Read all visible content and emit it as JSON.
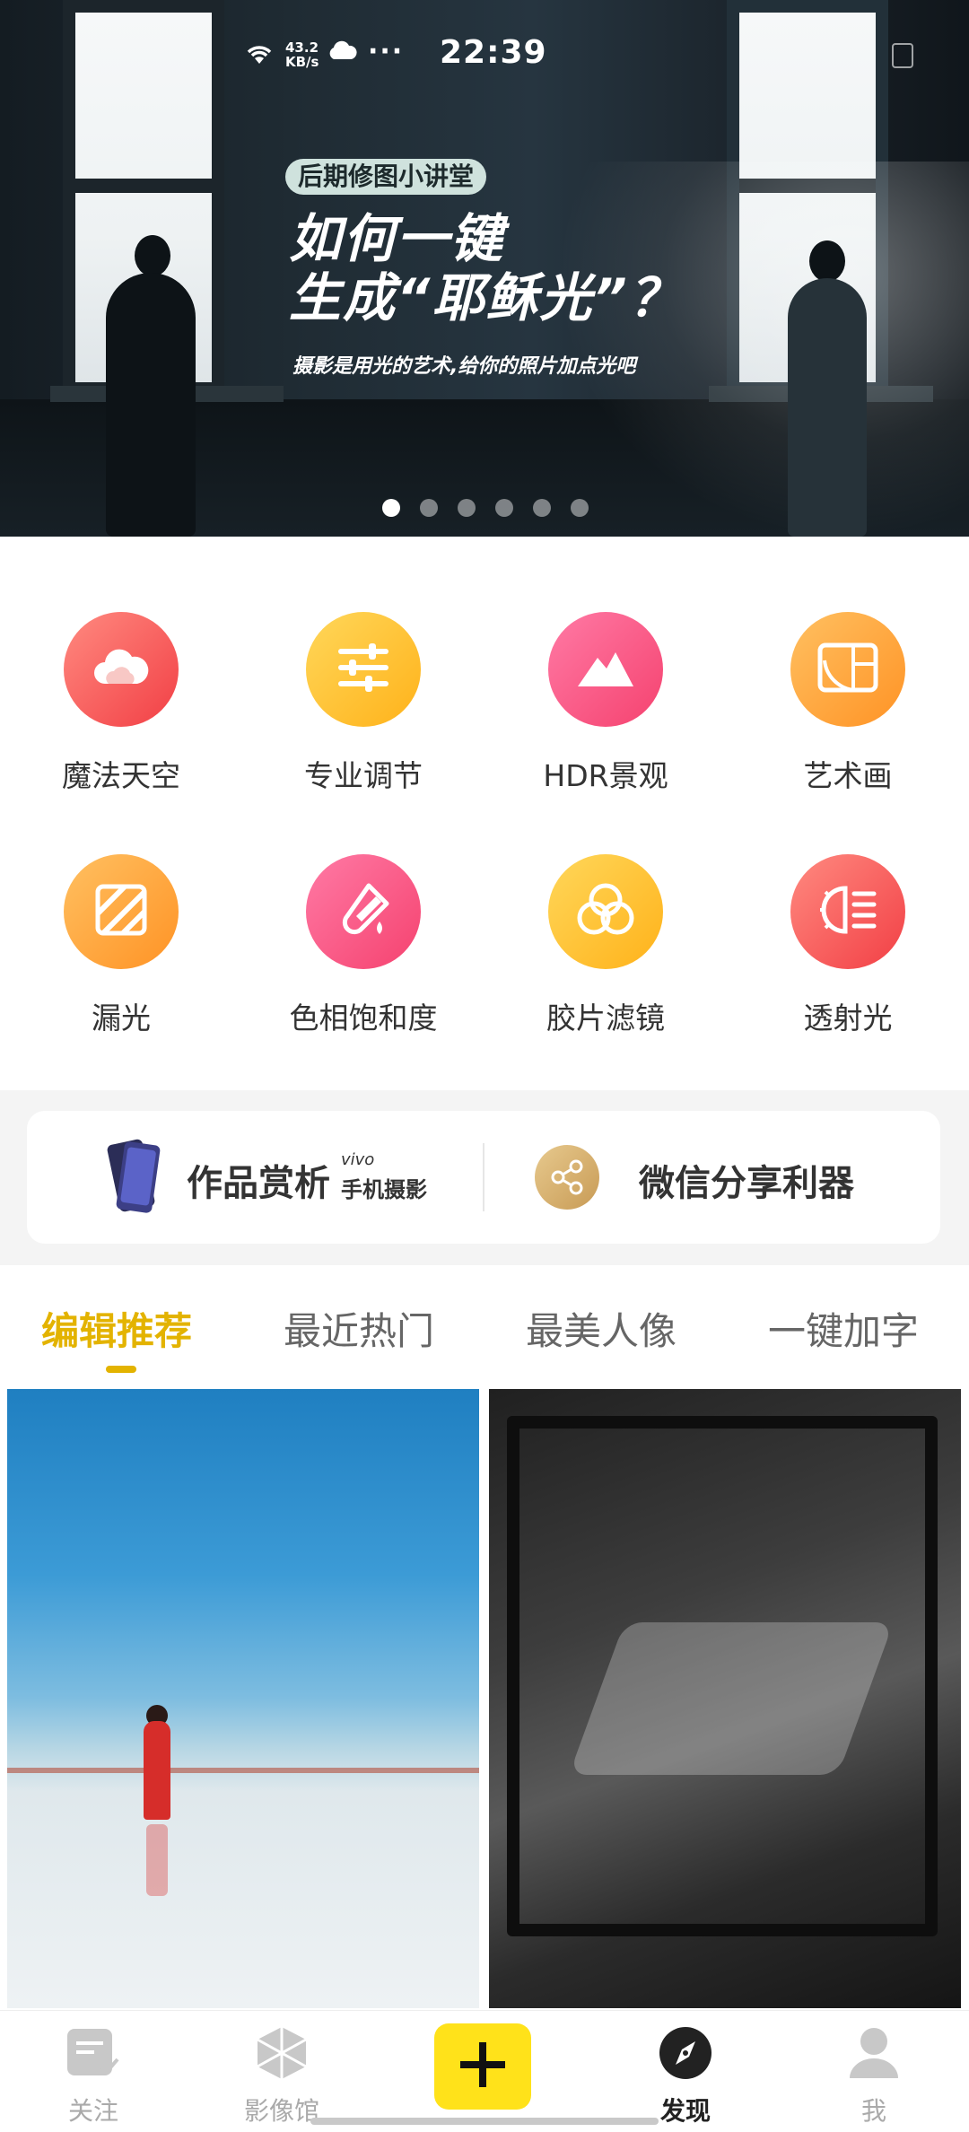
{
  "status_bar": {
    "net_speed_value": "43.2",
    "net_speed_unit": "KB/s",
    "more": "···",
    "time": "22:39",
    "icons": [
      "wifi-icon",
      "cloud-icon",
      "battery-icon"
    ]
  },
  "banner": {
    "tag": "后期修图小讲堂",
    "title_line1": "如何一键",
    "title_line2": "生成“耶稣光”？",
    "subtitle": "摄影是用光的艺术,给你的照片加点光吧",
    "page_count": 6,
    "active_index": 0
  },
  "tools": [
    {
      "label": "魔法天空",
      "icon": "cloud-icon",
      "color": "#f23f45"
    },
    {
      "label": "专业调节",
      "icon": "sliders-icon",
      "color": "#ffb21a"
    },
    {
      "label": "HDR景观",
      "icon": "mountain-icon",
      "color": "#f5426f"
    },
    {
      "label": "艺术画",
      "icon": "golden-ratio-icon",
      "color": "#ff9325"
    },
    {
      "label": "漏光",
      "icon": "light-leak-icon",
      "color": "#ff9325"
    },
    {
      "label": "色相饱和度",
      "icon": "test-tube-icon",
      "color": "#f5426f"
    },
    {
      "label": "胶片滤镜",
      "icon": "film-filter-icon",
      "color": "#ffb21a"
    },
    {
      "label": "透射光",
      "icon": "transmitted-light-icon",
      "color": "#f23f45"
    }
  ],
  "promo": {
    "left_label": "作品赏析",
    "left_brand": "vivo",
    "left_brand_sub": "手机摄影",
    "right_label": "微信分享利器"
  },
  "tabs": [
    {
      "label": "编辑推荐",
      "active": true
    },
    {
      "label": "最近热门",
      "active": false
    },
    {
      "label": "最美人像",
      "active": false
    },
    {
      "label": "一键加字",
      "active": false
    }
  ],
  "bottom_nav": [
    {
      "label": "关注",
      "icon": "follow-icon",
      "active": false
    },
    {
      "label": "影像馆",
      "icon": "gallery-icon",
      "active": false
    },
    {
      "label": "",
      "icon": "plus-icon",
      "active": false
    },
    {
      "label": "发现",
      "icon": "compass-icon",
      "active": true
    },
    {
      "label": "我",
      "icon": "user-icon",
      "active": false
    }
  ],
  "colors": {
    "accent": "#e3b300",
    "add_button": "#ffe21a"
  }
}
